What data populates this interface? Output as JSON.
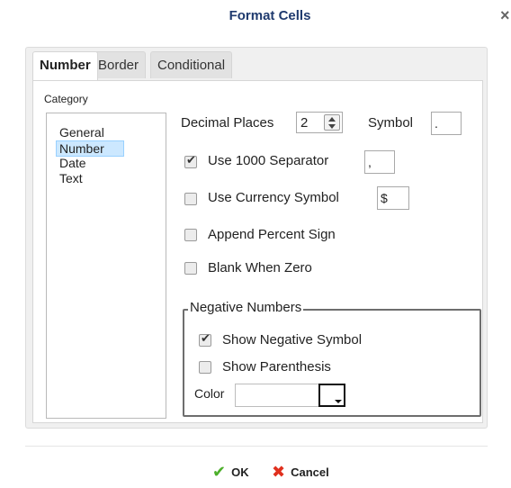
{
  "dialog": {
    "title": "Format Cells",
    "close_glyph": "×"
  },
  "tabs": [
    {
      "label": "Number",
      "active": true
    },
    {
      "label": "Border",
      "active": false
    },
    {
      "label": "Conditional",
      "active": false
    }
  ],
  "category": {
    "label": "Category",
    "items": [
      "General",
      "Number",
      "Date",
      "Text"
    ],
    "selected": "Number"
  },
  "number": {
    "decimal_places_label": "Decimal Places",
    "decimal_places_value": "2",
    "symbol_label": "Symbol",
    "symbol_value": ".",
    "use_separator_label": "Use 1000 Separator",
    "use_separator_checked": true,
    "separator_value": ",",
    "use_currency_label": "Use Currency Symbol",
    "use_currency_checked": false,
    "currency_value": "$",
    "append_percent_label": "Append Percent Sign",
    "append_percent_checked": false,
    "blank_zero_label": "Blank When Zero",
    "blank_zero_checked": false
  },
  "negative": {
    "group_title": "Negative Numbers",
    "show_symbol_label": "Show Negative Symbol",
    "show_symbol_checked": true,
    "show_parenthesis_label": "Show Parenthesis",
    "show_parenthesis_checked": false,
    "color_label": "Color",
    "color_value": ""
  },
  "footer": {
    "ok_label": "OK",
    "cancel_label": "Cancel"
  }
}
